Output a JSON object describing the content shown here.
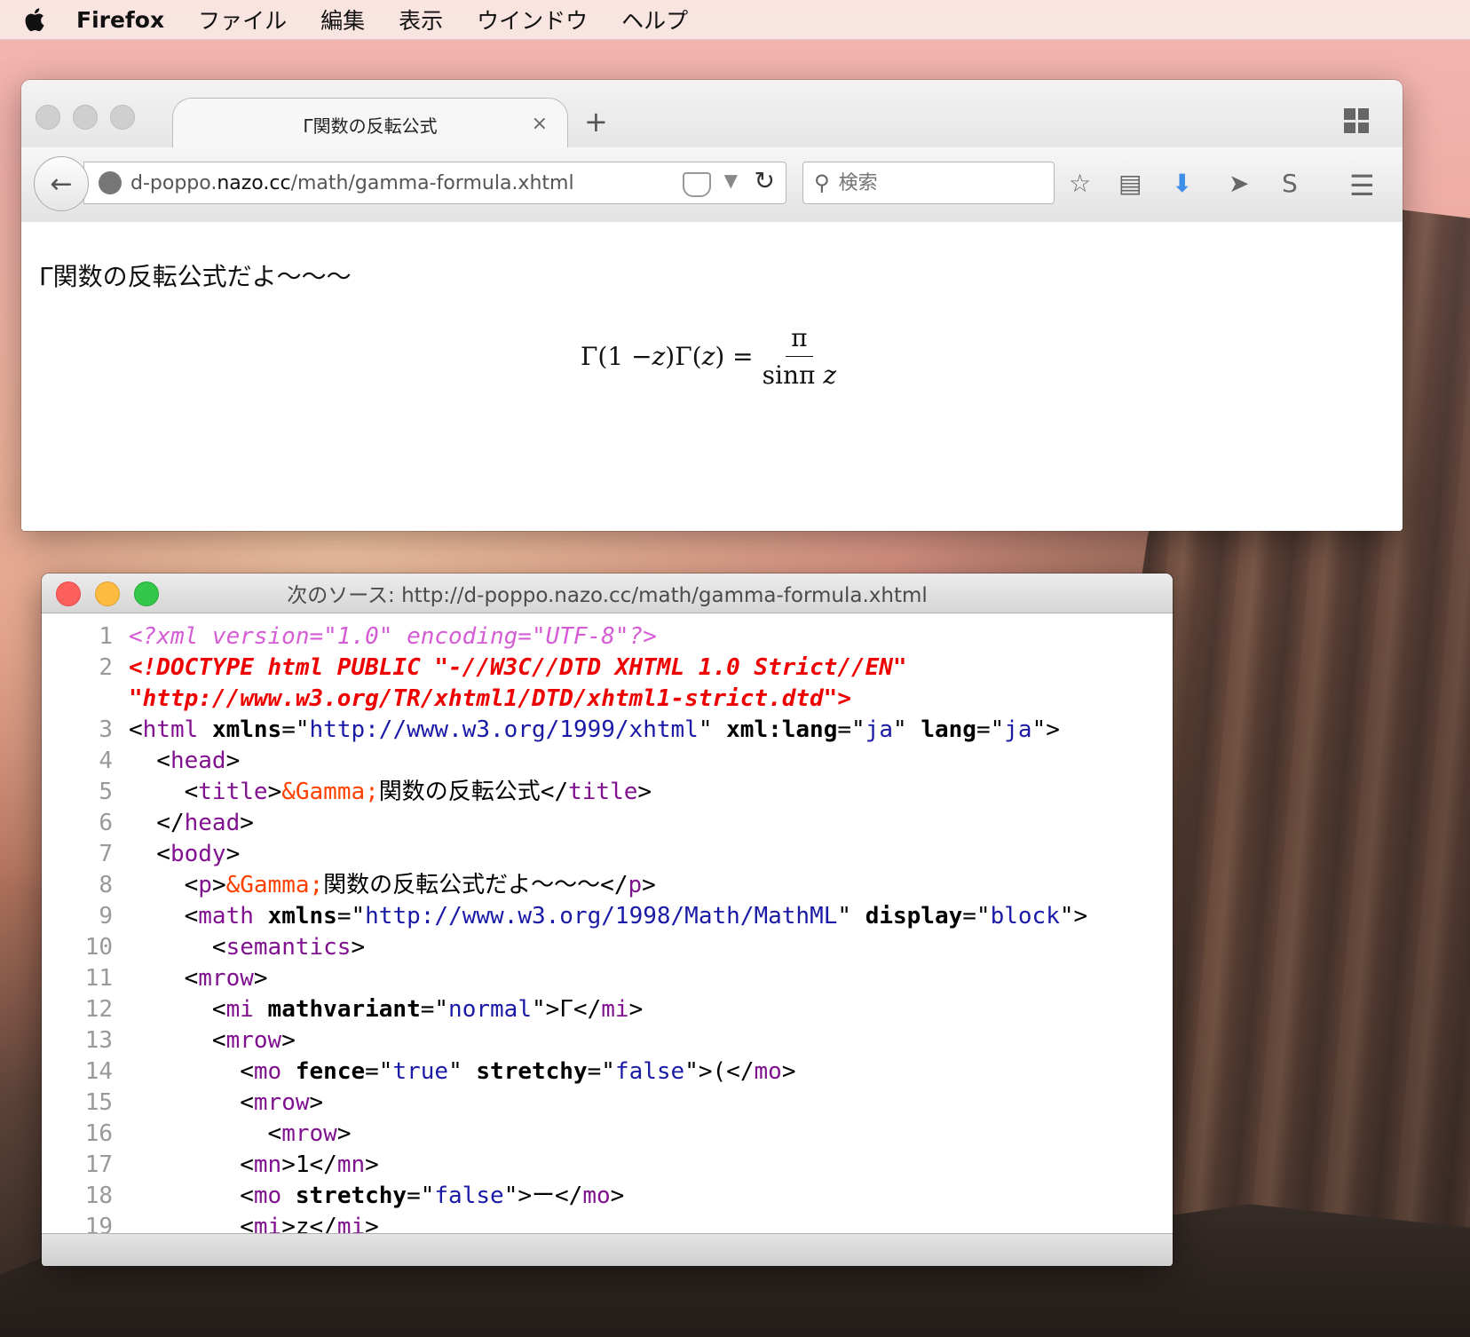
{
  "menubar": {
    "app_name": "Firefox",
    "items": [
      "ファイル",
      "編集",
      "表示",
      "ウインドウ",
      "ヘルプ"
    ]
  },
  "firefox": {
    "tab_title": "Γ関数の反転公式",
    "tab_close": "×",
    "new_tab": "+",
    "url_prefix": "d-poppo.",
    "url_host": "nazo.cc",
    "url_path": "/math/gamma-formula.xhtml",
    "search_placeholder": "検索",
    "content": {
      "paragraph": "Γ関数の反転公式だよ～～～",
      "formula_lhs": "Γ(1 − ",
      "formula_z1": "z",
      "formula_mid": ")Γ(",
      "formula_z2": "z",
      "formula_rhs": ") =",
      "numerator": "π",
      "denominator": "sinπ ",
      "denominator_z": "z"
    }
  },
  "source_window": {
    "title": "次のソース: http://d-poppo.nazo.cc/math/gamma-formula.xhtml",
    "lines": [
      {
        "n": "1",
        "segs": [
          [
            "pi",
            "<?xml version=\"1.0\" encoding=\"UTF-8\"?>"
          ]
        ]
      },
      {
        "n": "2",
        "segs": [
          [
            "dt",
            "<!DOCTYPE html PUBLIC \"-//W3C//DTD XHTML 1.0 Strict//EN\""
          ]
        ]
      },
      {
        "n": "",
        "segs": [
          [
            "dt",
            "\"http://www.w3.org/TR/xhtml1/DTD/xhtml1-strict.dtd\">"
          ]
        ]
      },
      {
        "n": "3",
        "segs": [
          [
            "txt",
            "<"
          ],
          [
            "tag",
            "html"
          ],
          [
            "txt",
            " "
          ],
          [
            "attr",
            "xmlns"
          ],
          [
            "txt",
            "=\""
          ],
          [
            "val",
            "http://www.w3.org/1999/xhtml"
          ],
          [
            "txt",
            "\" "
          ],
          [
            "attr",
            "xml:lang"
          ],
          [
            "txt",
            "=\""
          ],
          [
            "val",
            "ja"
          ],
          [
            "txt",
            "\" "
          ],
          [
            "attr",
            "lang"
          ],
          [
            "txt",
            "=\""
          ],
          [
            "val",
            "ja"
          ],
          [
            "txt",
            "\">"
          ]
        ]
      },
      {
        "n": "4",
        "segs": [
          [
            "txt",
            "  <"
          ],
          [
            "tag",
            "head"
          ],
          [
            "txt",
            ">"
          ]
        ]
      },
      {
        "n": "5",
        "segs": [
          [
            "txt",
            "    <"
          ],
          [
            "tag",
            "title"
          ],
          [
            "txt",
            ">"
          ],
          [
            "ent",
            "&Gamma;"
          ],
          [
            "txt",
            "関数の反転公式</"
          ],
          [
            "tag",
            "title"
          ],
          [
            "txt",
            ">"
          ]
        ]
      },
      {
        "n": "6",
        "segs": [
          [
            "txt",
            "  </"
          ],
          [
            "tag",
            "head"
          ],
          [
            "txt",
            ">"
          ]
        ]
      },
      {
        "n": "7",
        "segs": [
          [
            "txt",
            "  <"
          ],
          [
            "tag",
            "body"
          ],
          [
            "txt",
            ">"
          ]
        ]
      },
      {
        "n": "8",
        "segs": [
          [
            "txt",
            "    <"
          ],
          [
            "tag",
            "p"
          ],
          [
            "txt",
            ">"
          ],
          [
            "ent",
            "&Gamma;"
          ],
          [
            "txt",
            "関数の反転公式だよ～～～</"
          ],
          [
            "tag",
            "p"
          ],
          [
            "txt",
            ">"
          ]
        ]
      },
      {
        "n": "9",
        "segs": [
          [
            "txt",
            "    <"
          ],
          [
            "tag",
            "math"
          ],
          [
            "txt",
            " "
          ],
          [
            "attr",
            "xmlns"
          ],
          [
            "txt",
            "=\""
          ],
          [
            "val",
            "http://www.w3.org/1998/Math/MathML"
          ],
          [
            "txt",
            "\" "
          ],
          [
            "attr",
            "display"
          ],
          [
            "txt",
            "=\""
          ],
          [
            "val",
            "block"
          ],
          [
            "txt",
            "\">"
          ]
        ]
      },
      {
        "n": "10",
        "segs": [
          [
            "txt",
            "      <"
          ],
          [
            "tag",
            "semantics"
          ],
          [
            "txt",
            ">"
          ]
        ]
      },
      {
        "n": "11",
        "segs": [
          [
            "txt",
            "    <"
          ],
          [
            "tag",
            "mrow"
          ],
          [
            "txt",
            ">"
          ]
        ]
      },
      {
        "n": "12",
        "segs": [
          [
            "txt",
            "      <"
          ],
          [
            "tag",
            "mi"
          ],
          [
            "txt",
            " "
          ],
          [
            "attr",
            "mathvariant"
          ],
          [
            "txt",
            "=\""
          ],
          [
            "val",
            "normal"
          ],
          [
            "txt",
            "\">Γ</"
          ],
          [
            "tag",
            "mi"
          ],
          [
            "txt",
            ">"
          ]
        ]
      },
      {
        "n": "13",
        "segs": [
          [
            "txt",
            "      <"
          ],
          [
            "tag",
            "mrow"
          ],
          [
            "txt",
            ">"
          ]
        ]
      },
      {
        "n": "14",
        "segs": [
          [
            "txt",
            "        <"
          ],
          [
            "tag",
            "mo"
          ],
          [
            "txt",
            " "
          ],
          [
            "attr",
            "fence"
          ],
          [
            "txt",
            "=\""
          ],
          [
            "val",
            "true"
          ],
          [
            "txt",
            "\" "
          ],
          [
            "attr",
            "stretchy"
          ],
          [
            "txt",
            "=\""
          ],
          [
            "val",
            "false"
          ],
          [
            "txt",
            "\">(</"
          ],
          [
            "tag",
            "mo"
          ],
          [
            "txt",
            ">"
          ]
        ]
      },
      {
        "n": "15",
        "segs": [
          [
            "txt",
            "        <"
          ],
          [
            "tag",
            "mrow"
          ],
          [
            "txt",
            ">"
          ]
        ]
      },
      {
        "n": "16",
        "segs": [
          [
            "txt",
            "          <"
          ],
          [
            "tag",
            "mrow"
          ],
          [
            "txt",
            ">"
          ]
        ]
      },
      {
        "n": "17",
        "segs": [
          [
            "txt",
            "        <"
          ],
          [
            "tag",
            "mn"
          ],
          [
            "txt",
            ">1</"
          ],
          [
            "tag",
            "mn"
          ],
          [
            "txt",
            ">"
          ]
        ]
      },
      {
        "n": "18",
        "segs": [
          [
            "txt",
            "        <"
          ],
          [
            "tag",
            "mo"
          ],
          [
            "txt",
            " "
          ],
          [
            "attr",
            "stretchy"
          ],
          [
            "txt",
            "=\""
          ],
          [
            "val",
            "false"
          ],
          [
            "txt",
            "\">ー</"
          ],
          [
            "tag",
            "mo"
          ],
          [
            "txt",
            ">"
          ]
        ]
      },
      {
        "n": "19",
        "segs": [
          [
            "txt",
            "        <"
          ],
          [
            "tag",
            "mi"
          ],
          [
            "txt",
            ">z</"
          ],
          [
            "tag",
            "mi"
          ],
          [
            "txt",
            ">"
          ]
        ]
      }
    ]
  }
}
